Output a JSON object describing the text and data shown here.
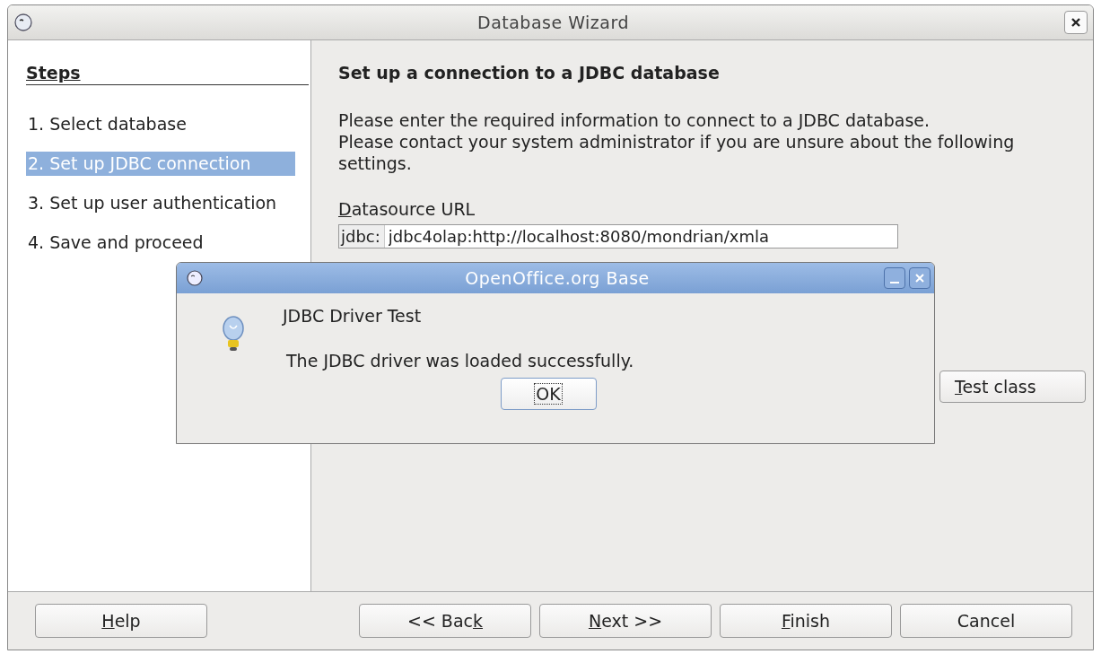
{
  "window": {
    "title": "Database Wizard"
  },
  "steps": {
    "heading": "Steps",
    "items": [
      {
        "label": "1. Select database",
        "selected": false
      },
      {
        "label": "2. Set up JDBC connection",
        "selected": true
      },
      {
        "label": "3. Set up user authentication",
        "selected": false
      },
      {
        "label": "4. Save and proceed",
        "selected": false
      }
    ]
  },
  "page": {
    "title": "Set up a connection to a JDBC database",
    "intro": [
      "Please enter the required information to connect to a JDBC database.",
      "Please contact your system administrator if you are unsure about the following settings."
    ],
    "url_label": {
      "parts": [
        {
          "text": "D",
          "underlined": true
        },
        {
          "text": "atasource URL",
          "underlined": false
        }
      ]
    },
    "url_prefix": "jdbc:",
    "url_value": "jdbc4olap:http://localhost:8080/mondrian/xmla",
    "test_button": {
      "parts": [
        {
          "text": "T",
          "underlined": true
        },
        {
          "text": "est class",
          "underlined": false
        }
      ]
    }
  },
  "buttons": [
    {
      "parts": [
        {
          "text": "H",
          "underlined": true
        },
        {
          "text": "elp",
          "underlined": false
        }
      ]
    },
    {
      "parts": [
        {
          "text": "<< Bac",
          "underlined": false
        },
        {
          "text": "k",
          "underlined": true
        }
      ]
    },
    {
      "parts": [
        {
          "text": "N",
          "underlined": true
        },
        {
          "text": "ext >>",
          "underlined": false
        }
      ]
    },
    {
      "parts": [
        {
          "text": "F",
          "underlined": true
        },
        {
          "text": "inish",
          "underlined": false
        }
      ]
    },
    {
      "parts": [
        {
          "text": "Cancel",
          "underlined": false
        }
      ]
    }
  ],
  "dialog": {
    "title": "OpenOffice.org Base",
    "heading": "JDBC Driver Test",
    "message": "The JDBC driver was loaded successfully.",
    "ok": "OK"
  }
}
